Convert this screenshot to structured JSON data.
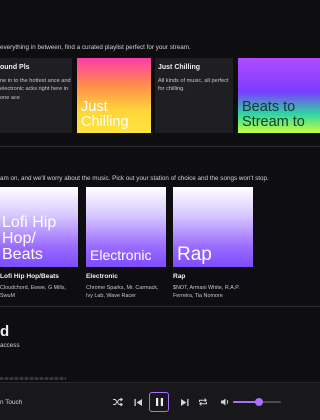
{
  "playlists": {
    "intro": "everything in between, find a curated playlist perfect for your stream.",
    "items": [
      {
        "title": "ound Pls",
        "desc": "ne in to the hottest ance and electronic acks right here in one ace"
      },
      {
        "art_label": "Just Chilling"
      },
      {
        "title": "Just Chilling",
        "desc": "All kinds of music, all perfect for chilling."
      },
      {
        "art_label": "Beats to Stream to"
      }
    ]
  },
  "stations": {
    "intro": "am on, and we'll worry about the music. Pick out your station of choice and the songs won't stop.",
    "items": [
      {
        "art_label": "Lofi Hip Hop/ Beats",
        "title": "Lofi Hip Hop/Beats",
        "desc": "Cloudchord, Ewwe, G Mills, SwuM"
      },
      {
        "art_label": "Electronic",
        "title": "Electronic",
        "desc": "Chrome Sparks, Mr. Carmack, Ivy Lab, Wave Racer"
      },
      {
        "art_label": "Rap",
        "title": "Rap",
        "desc": "$NOT, Armani White, R.A.P. Ferreira, Tia Nomore"
      }
    ]
  },
  "section3": {
    "heading": "d",
    "subtext": "access"
  },
  "player": {
    "now_playing": "n Touch",
    "accent": "#a970ff",
    "volume": 0.55,
    "icons": [
      "shuffle-icon",
      "previous-icon",
      "pause-icon",
      "next-icon",
      "repeat-icon",
      "volume-icon"
    ]
  }
}
